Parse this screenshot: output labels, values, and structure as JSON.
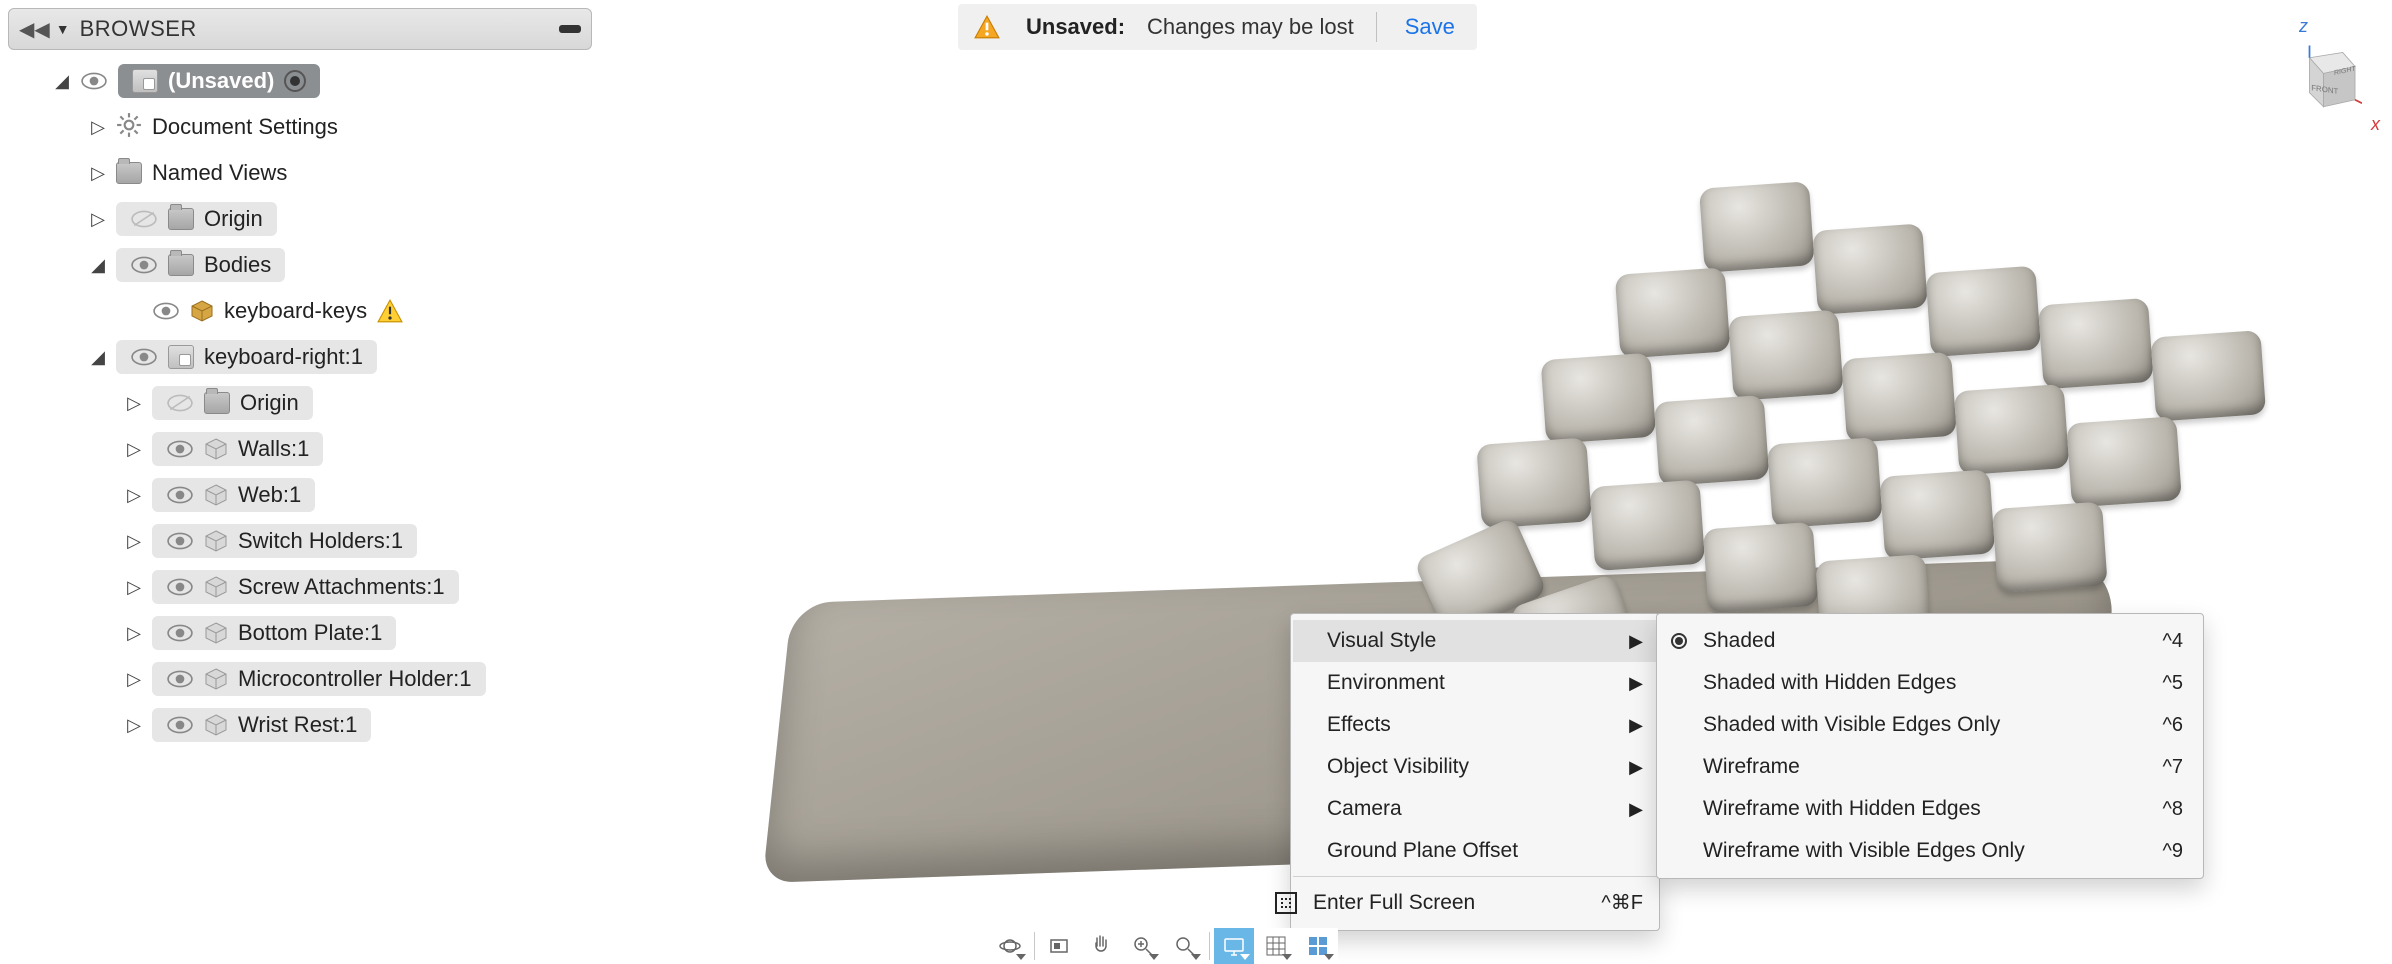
{
  "browser": {
    "title": "BROWSER",
    "root": {
      "label": "(Unsaved)"
    },
    "items": {
      "doc_settings": "Document Settings",
      "named_views": "Named Views",
      "origin1": "Origin",
      "bodies": "Bodies",
      "keyboard_keys": "keyboard-keys",
      "comp1": "keyboard-right:1",
      "origin2": "Origin",
      "walls": "Walls:1",
      "web": "Web:1",
      "switch_holders": "Switch Holders:1",
      "screw_attach": "Screw Attachments:1",
      "bottom_plate": "Bottom Plate:1",
      "mcu_holder": "Microcontroller Holder:1",
      "wrist_rest": "Wrist Rest:1"
    }
  },
  "unsaved": {
    "label": "Unsaved:",
    "message": "Changes may be lost",
    "action": "Save"
  },
  "context_menu": {
    "items": [
      {
        "label": "Visual Style",
        "submenu": true
      },
      {
        "label": "Environment",
        "submenu": true
      },
      {
        "label": "Effects",
        "submenu": true
      },
      {
        "label": "Object Visibility",
        "submenu": true
      },
      {
        "label": "Camera",
        "submenu": true
      },
      {
        "label": "Ground Plane Offset",
        "submenu": false
      }
    ],
    "fullscreen": {
      "label": "Enter Full Screen",
      "shortcut": "^⌘F"
    }
  },
  "visual_style_menu": {
    "items": [
      {
        "label": "Shaded",
        "shortcut": "^4",
        "selected": true
      },
      {
        "label": "Shaded with Hidden Edges",
        "shortcut": "^5",
        "selected": false
      },
      {
        "label": "Shaded with Visible Edges Only",
        "shortcut": "^6",
        "selected": false
      },
      {
        "label": "Wireframe",
        "shortcut": "^7",
        "selected": false
      },
      {
        "label": "Wireframe with Hidden Edges",
        "shortcut": "^8",
        "selected": false
      },
      {
        "label": "Wireframe with Visible Edges Only",
        "shortcut": "^9",
        "selected": false
      }
    ]
  },
  "viewcube": {
    "front": "FRONT",
    "right": "RIGHT",
    "z": "z",
    "x": "x"
  },
  "toolbar": {
    "orbit": "orbit",
    "look": "look",
    "pan": "pan",
    "zoom": "zoom",
    "fit": "fit",
    "display": "display",
    "grid": "grid",
    "viewports": "viewports"
  }
}
